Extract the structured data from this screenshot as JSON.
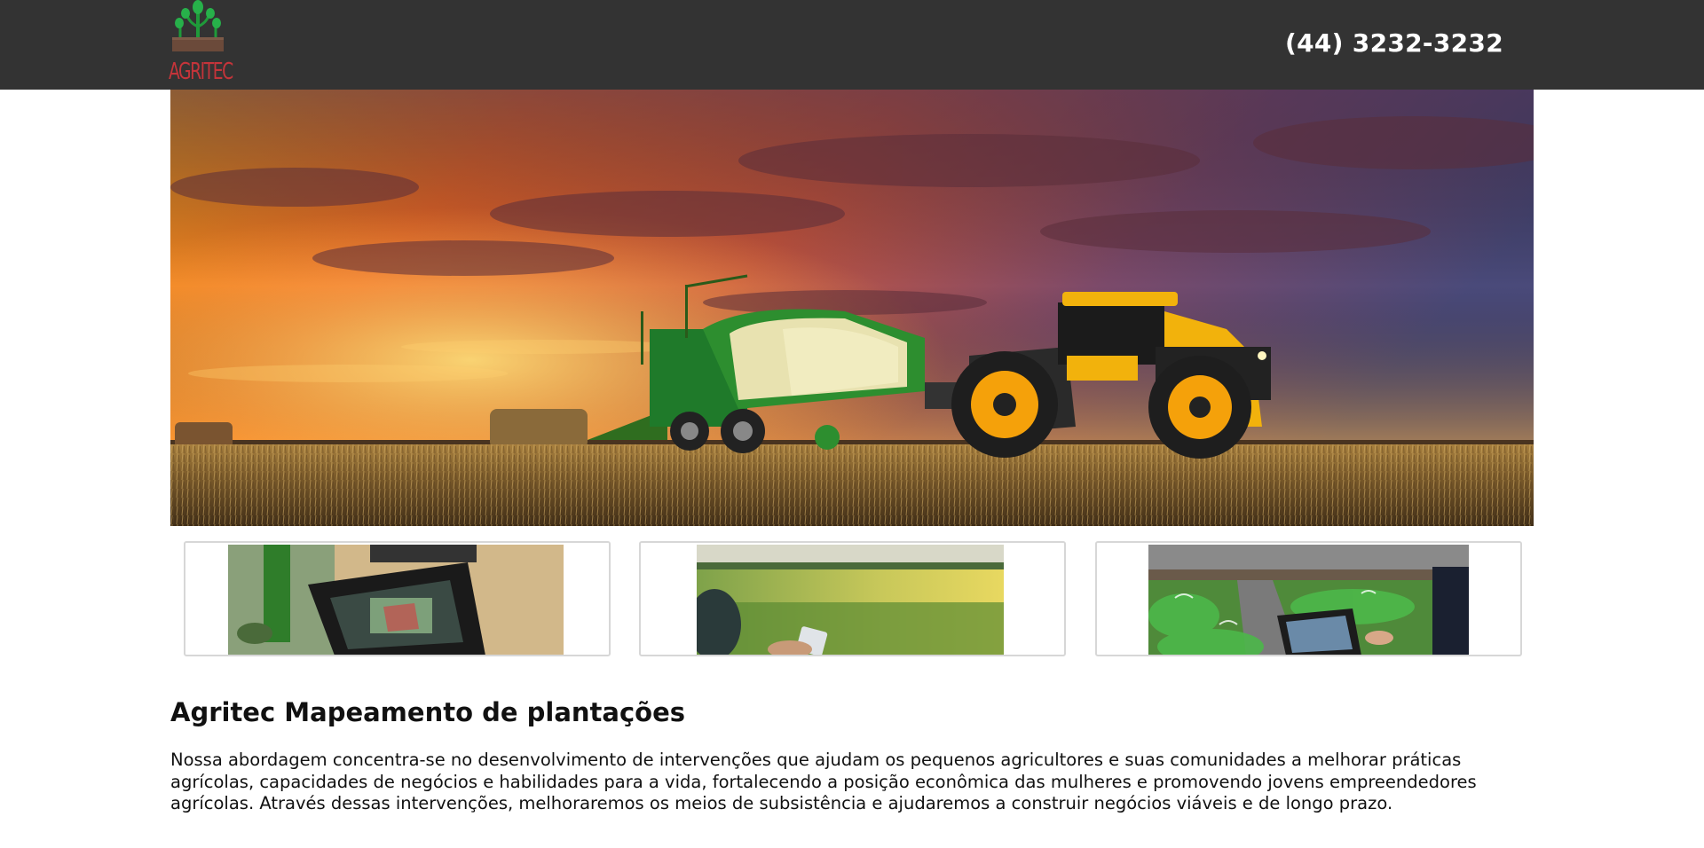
{
  "header": {
    "logo_text": "AGRITEC",
    "phone": "(44) 3232-3232",
    "background_color": "#333333",
    "logo_color": "#c4343a"
  },
  "hero": {
    "image": "tractor-with-baler-sunset-field-image"
  },
  "thumbnails": [
    {
      "image": "tractor-gps-display-image"
    },
    {
      "image": "phone-in-green-field-image"
    },
    {
      "image": "tablet-smart-greenhouse-image"
    }
  ],
  "content": {
    "title": "Agritec Mapeamento de plantações",
    "description": "Nossa abordagem concentra-se no desenvolvimento de intervenções que ajudam os pequenos agricultores e suas comunidades a melhorar práticas agrícolas, capacidades de negócios e habilidades para a vida, fortalecendo a posição econômica das mulheres e promovendo jovens empreendedores agrícolas. Através dessas intervenções, melhoraremos os meios de subsistência e ajudaremos a construir negócios viáveis e de longo prazo."
  }
}
